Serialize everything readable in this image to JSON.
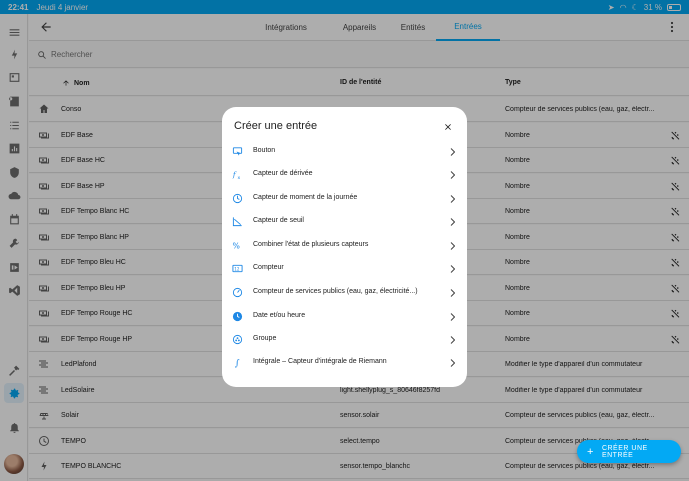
{
  "status": {
    "time": "22:41",
    "date": "Jeudi 4 janvier",
    "battery": "31 %"
  },
  "sidebar": {
    "icons": [
      "menu-icon",
      "energy-icon",
      "map-icon",
      "logbook-icon",
      "history-icon",
      "shield-icon",
      "cloud-icon",
      "calendar-icon",
      "tools-icon",
      "media-icon",
      "vscode-icon",
      "hammer-icon",
      "settings-icon",
      "bell-icon"
    ],
    "active": "settings-icon"
  },
  "tabs": [
    "Intégrations",
    "Appareils",
    "Entités",
    "Entrées"
  ],
  "active_tab": "Entrées",
  "search": {
    "placeholder": "Rechercher"
  },
  "table": {
    "headers": [
      "Nom",
      "ID de l'entité",
      "Type"
    ],
    "rows": [
      {
        "icon": "home-icon",
        "name": "Conso",
        "id": "",
        "type": "Compteur de services publics (eau, gaz, électr..."
      },
      {
        "icon": "cash-icon",
        "name": "EDF Base",
        "id": "",
        "type": "Nombre"
      },
      {
        "icon": "cash-icon",
        "name": "EDF Base HC",
        "id": "",
        "type": "Nombre"
      },
      {
        "icon": "cash-icon",
        "name": "EDF Base HP",
        "id": "",
        "type": "Nombre"
      },
      {
        "icon": "cash-icon",
        "name": "EDF Tempo Blanc HC",
        "id": "",
        "type": "Nombre"
      },
      {
        "icon": "cash-icon",
        "name": "EDF Tempo Blanc HP",
        "id": "",
        "type": "Nombre"
      },
      {
        "icon": "cash-icon",
        "name": "EDF Tempo Bleu HC",
        "id": "",
        "type": "Nombre"
      },
      {
        "icon": "cash-icon",
        "name": "EDF Tempo Bleu HP",
        "id": "",
        "type": "Nombre"
      },
      {
        "icon": "cash-icon",
        "name": "EDF Tempo Rouge HC",
        "id": "",
        "type": "Nombre"
      },
      {
        "icon": "cash-icon",
        "name": "EDF Tempo Rouge HP",
        "id": "",
        "type": "Nombre"
      },
      {
        "icon": "ceiling-light-icon",
        "name": "LedPlafond",
        "id": "",
        "type": "Modifier le type d'appareil d'un commutateur"
      },
      {
        "icon": "ceiling-light-icon",
        "name": "LedSolaire",
        "id": "light.shellyplug_s_80646f8257fd",
        "type": "Modifier le type d'appareil d'un commutateur"
      },
      {
        "icon": "solar-panel-icon",
        "name": "Solair",
        "id": "sensor.solair",
        "type": "Compteur de services publics (eau, gaz, électr..."
      },
      {
        "icon": "clock-icon",
        "name": "TEMPO",
        "id": "select.tempo",
        "type": "Compteur de services publics (eau, gaz, électr..."
      },
      {
        "icon": "flash-icon",
        "name": "TEMPO BLANCHC",
        "id": "sensor.tempo_blanchc",
        "type": "Compteur de services publics (eau, gaz, électr..."
      }
    ]
  },
  "dialog": {
    "title": "Créer une entrée",
    "items": [
      {
        "icon": "button-icon",
        "label": "Bouton"
      },
      {
        "icon": "derivative-icon",
        "label": "Capteur de dérivée"
      },
      {
        "icon": "time-of-day-icon",
        "label": "Capteur de moment de la journée"
      },
      {
        "icon": "threshold-icon",
        "label": "Capteur de seuil"
      },
      {
        "icon": "min-max-icon",
        "label": "Combiner l'état de plusieurs capteurs"
      },
      {
        "icon": "counter-icon",
        "label": "Compteur"
      },
      {
        "icon": "utility-meter-icon",
        "label": "Compteur de services publics (eau, gaz, électricité...)"
      },
      {
        "icon": "date-time-icon",
        "label": "Date et/ou heure"
      },
      {
        "icon": "group-icon",
        "label": "Groupe"
      },
      {
        "icon": "integral-icon",
        "label": "Intégrale – Capteur d'intégrale de Riemann"
      }
    ]
  },
  "fab": {
    "label": "CRÉER UNE ENTRÉE"
  },
  "colors": {
    "accent": "#03a9f4",
    "icon_blue": "#1e88e5"
  }
}
